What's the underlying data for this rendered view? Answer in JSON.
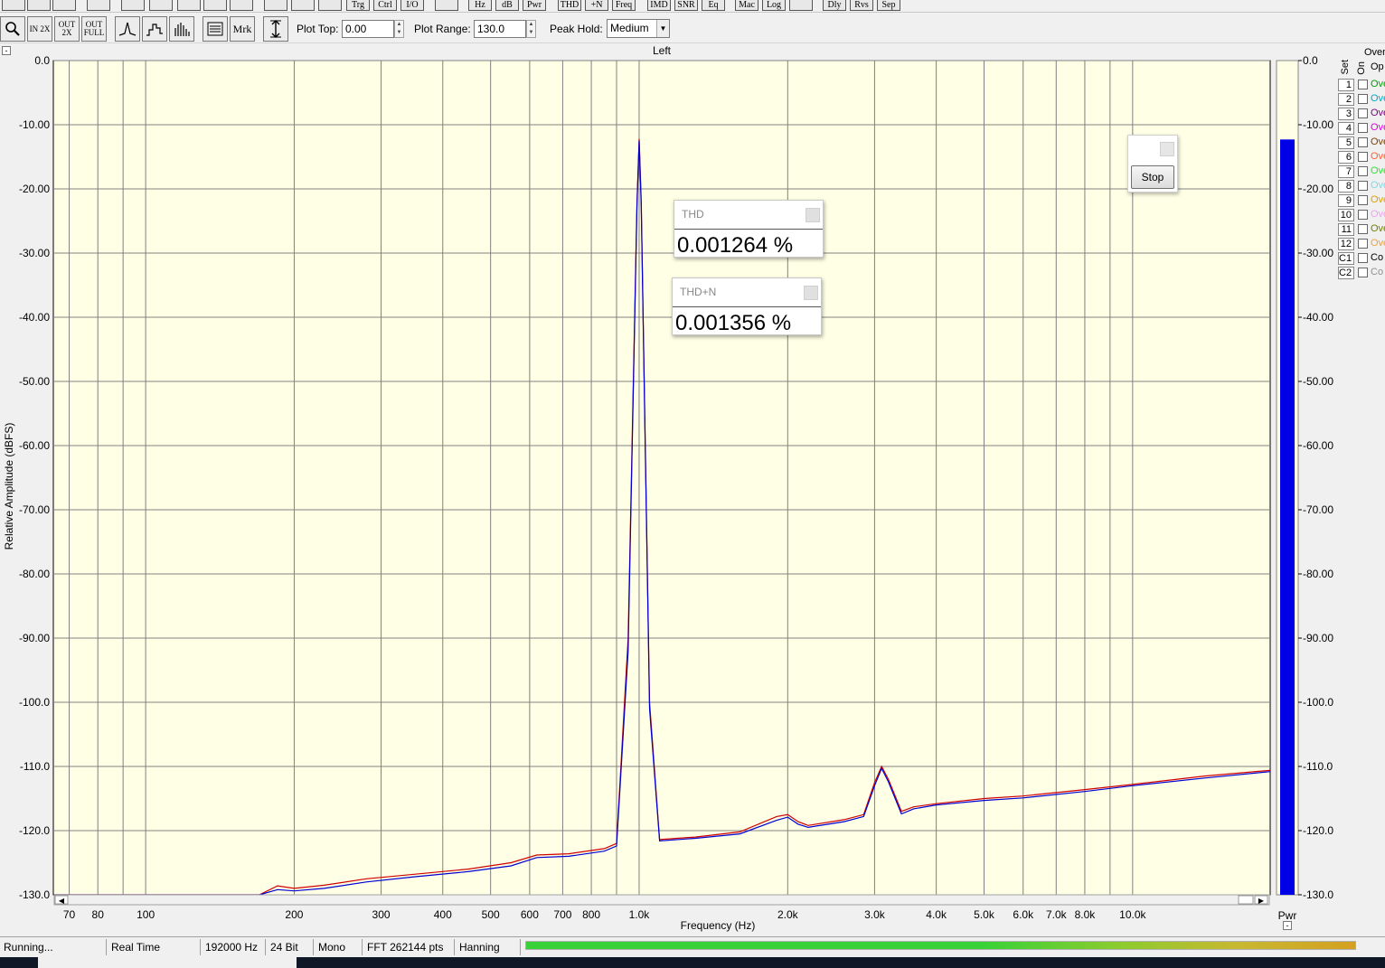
{
  "window": {
    "channel_title": "Left"
  },
  "toolbar": {
    "mrk_label": "Mrk",
    "in_2x_label": "IN 2X",
    "out_2x_label": "OUT 2X",
    "out_full_label": "OUT FULL",
    "plot_top_label": "Plot Top:",
    "plot_top_value": "0.00",
    "plot_range_label": "Plot Range:",
    "plot_range_value": "130.0",
    "peak_hold_label": "Peak Hold:",
    "peak_hold_value": "Medium"
  },
  "top_toolbar_labels": [
    "Hz",
    "dB",
    "Pwr",
    "THD",
    "+N",
    "Freq",
    "IMD",
    "SNR",
    "Eq",
    "Mac",
    "Log",
    "Dly",
    "Rvs",
    "Sep",
    "Ctrl",
    "I/O",
    "Trg"
  ],
  "readouts": [
    {
      "title": "THD",
      "value": "0.001264 %"
    },
    {
      "title": "THD+N",
      "value": "0.001356 %"
    }
  ],
  "stop_button": {
    "label": "Stop"
  },
  "overlay_panel": {
    "header": "Over",
    "col_set": "Set",
    "col_on": "On",
    "col_op": "Op",
    "rows": [
      {
        "num": "1",
        "name": "Ove",
        "color": "#00a000"
      },
      {
        "num": "2",
        "name": "Ove",
        "color": "#00a8c8"
      },
      {
        "num": "3",
        "name": "Ove",
        "color": "#800080"
      },
      {
        "num": "4",
        "name": "Ove",
        "color": "#e000e0"
      },
      {
        "num": "5",
        "name": "Ove",
        "color": "#804000"
      },
      {
        "num": "6",
        "name": "Ove",
        "color": "#ff6030"
      },
      {
        "num": "7",
        "name": "Ove",
        "color": "#30e030"
      },
      {
        "num": "8",
        "name": "Ove",
        "color": "#80d8e8"
      },
      {
        "num": "9",
        "name": "Ove",
        "color": "#e0a000"
      },
      {
        "num": "10",
        "name": "Ove",
        "color": "#f0a0f0"
      },
      {
        "num": "11",
        "name": "Ove",
        "color": "#708000"
      },
      {
        "num": "12",
        "name": "Ove",
        "color": "#f0a040"
      },
      {
        "num": "C1",
        "name": "Co",
        "color": "#000000"
      },
      {
        "num": "C2",
        "name": "Co",
        "color": "#909090"
      }
    ]
  },
  "status": {
    "state": "Running...",
    "mode": "Real Time",
    "sample_rate": "192000 Hz",
    "bit_depth": "24 Bit",
    "channels": "Mono",
    "fft": "FFT 262144 pts",
    "window": "Hanning"
  },
  "chart_data": {
    "type": "line",
    "xlabel": "Frequency (Hz)",
    "ylabel": "Relative Amplitude (dBFS)",
    "xscale": "log",
    "xlim": [
      65,
      19000
    ],
    "ylim": [
      -130,
      0
    ],
    "x_tick_labels": [
      "70",
      "80",
      "100",
      "200",
      "300",
      "400",
      "500",
      "600",
      "700",
      "800",
      "1.0k",
      "2.0k",
      "3.0k",
      "4.0k",
      "5.0k",
      "6.0k",
      "7.0k",
      "8.0k",
      "10.0k"
    ],
    "x_tick_values": [
      70,
      80,
      100,
      200,
      300,
      400,
      500,
      600,
      700,
      800,
      1000,
      2000,
      3000,
      4000,
      5000,
      6000,
      7000,
      8000,
      10000
    ],
    "y_tick_labels": [
      "0.0",
      "-10.00",
      "-20.00",
      "-30.00",
      "-40.00",
      "-50.00",
      "-60.00",
      "-70.00",
      "-80.00",
      "-90.00",
      "-100.0",
      "-110.0",
      "-120.0",
      "-130.0"
    ],
    "y_tick_values": [
      0,
      -10,
      -20,
      -30,
      -40,
      -50,
      -60,
      -70,
      -80,
      -90,
      -100,
      -110,
      -120,
      -130
    ],
    "grid": true,
    "background": "#ffffe6",
    "series": [
      {
        "color": "#d00000",
        "x": [
          65,
          170,
          185,
          200,
          230,
          280,
          350,
          450,
          550,
          620,
          720,
          850,
          900,
          950,
          990,
          1000,
          1010,
          1050,
          1100,
          1300,
          1600,
          1900,
          2000,
          2100,
          2200,
          2600,
          2850,
          3000,
          3100,
          3200,
          3400,
          3600,
          4000,
          5000,
          6000,
          8000,
          10000,
          14000,
          19000
        ],
        "y": [
          -130,
          -130,
          -128.6,
          -129,
          -128.5,
          -127.5,
          -126.8,
          -126,
          -125,
          -123.8,
          -123.6,
          -122.8,
          -122,
          -90,
          -22,
          -12.2,
          -22,
          -100,
          -121.4,
          -121,
          -120.2,
          -117.8,
          -117.5,
          -118.6,
          -119.2,
          -118.3,
          -117.5,
          -112.5,
          -110,
          -112,
          -117,
          -116.3,
          -115.8,
          -115,
          -114.6,
          -113.6,
          -112.8,
          -111.5,
          -110.6
        ]
      },
      {
        "color": "#0000d0",
        "x": [
          65,
          170,
          185,
          200,
          230,
          280,
          350,
          450,
          550,
          620,
          720,
          850,
          900,
          950,
          990,
          1000,
          1010,
          1050,
          1100,
          1300,
          1600,
          1900,
          2000,
          2100,
          2200,
          2600,
          2850,
          3000,
          3100,
          3200,
          3400,
          3600,
          4000,
          5000,
          6000,
          8000,
          10000,
          14000,
          19000
        ],
        "y": [
          -130,
          -130,
          -129.2,
          -129.4,
          -129,
          -128,
          -127.2,
          -126.4,
          -125.5,
          -124.2,
          -124,
          -123.2,
          -122.4,
          -92,
          -22.5,
          -12.5,
          -22.5,
          -101,
          -121.6,
          -121.2,
          -120.5,
          -118.4,
          -117.9,
          -119,
          -119.5,
          -118.6,
          -117.8,
          -113,
          -110.3,
          -112.4,
          -117.4,
          -116.6,
          -116,
          -115.3,
          -114.9,
          -113.9,
          -113,
          -111.8,
          -110.8
        ]
      }
    ],
    "power_meter": {
      "label": "Pwr",
      "level_dbfs": -12.3,
      "scale_labels": [
        "0.0",
        "-10.00",
        "-20.00",
        "-30.00",
        "-40.00",
        "-50.00",
        "-60.00",
        "-70.00",
        "-80.00",
        "-90.00",
        "-100.0",
        "-110.0",
        "-120.0",
        "-130.0"
      ]
    }
  }
}
